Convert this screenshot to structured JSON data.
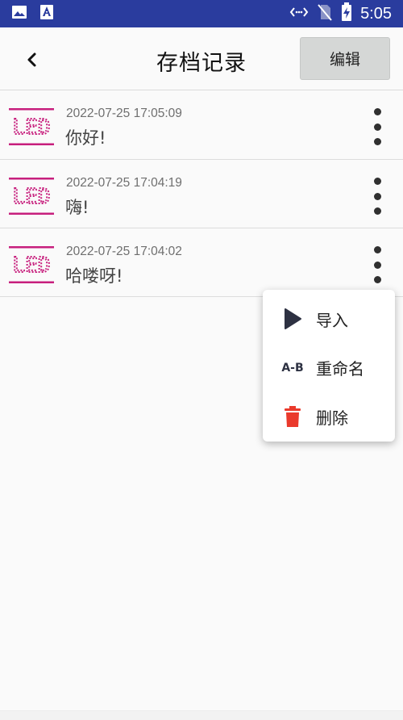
{
  "status_bar": {
    "time": "5:05",
    "icons": [
      "image-icon",
      "text-a-icon",
      "data-sync-icon",
      "no-sim-icon",
      "battery-charging-icon"
    ]
  },
  "header": {
    "title": "存档记录",
    "edit_label": "编辑"
  },
  "records": [
    {
      "date": "2022-07-25 17:05:09",
      "text": "你好!"
    },
    {
      "date": "2022-07-25 17:04:19",
      "text": "嗨!"
    },
    {
      "date": "2022-07-25 17:04:02",
      "text": "哈喽呀!"
    }
  ],
  "thumbnail": {
    "text": "LED",
    "color": "#c71f7d"
  },
  "menu": {
    "items": [
      {
        "label": "导入",
        "icon": "play-icon"
      },
      {
        "label": "重命名",
        "icon": "rename-ab-icon"
      },
      {
        "label": "删除",
        "icon": "trash-icon"
      }
    ],
    "rename_icon_text": "A-B"
  },
  "colors": {
    "status_bar": "#2a3c9e",
    "delete_red": "#ea3a2c",
    "led_magenta": "#c71f7d"
  }
}
